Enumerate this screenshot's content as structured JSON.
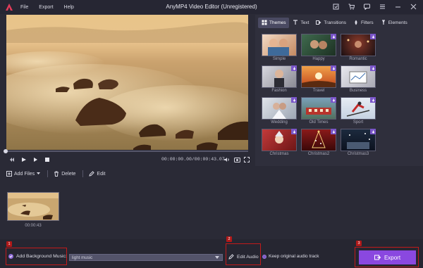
{
  "window": {
    "title": "AnyMP4 Video Editor (Unregistered)",
    "menu": [
      "File",
      "Export",
      "Help"
    ],
    "icons": [
      "register-icon",
      "cart-icon",
      "feedback-icon",
      "menu-icon",
      "minimize-icon",
      "close-icon"
    ]
  },
  "player": {
    "timecode": "00:00:00.00/00:00:43.07",
    "progress": 0.0
  },
  "panel": {
    "tabs": [
      {
        "label": "Themes",
        "icon": "themes-icon"
      },
      {
        "label": "Text",
        "icon": "text-icon"
      },
      {
        "label": "Transitions",
        "icon": "transitions-icon"
      },
      {
        "label": "Filters",
        "icon": "filters-icon"
      },
      {
        "label": "Elements",
        "icon": "elements-icon"
      }
    ],
    "themes": [
      {
        "label": "Simple",
        "download": false
      },
      {
        "label": "Happy",
        "download": true
      },
      {
        "label": "Romantic",
        "download": true
      },
      {
        "label": "Fashion",
        "download": true
      },
      {
        "label": "Travel",
        "download": true
      },
      {
        "label": "Business",
        "download": true
      },
      {
        "label": "Wedding",
        "download": true
      },
      {
        "label": "Old Times",
        "download": true
      },
      {
        "label": "Sport",
        "download": true
      },
      {
        "label": "Christmas",
        "download": true
      },
      {
        "label": "Christmas2",
        "download": true
      },
      {
        "label": "Christmas3",
        "download": true
      }
    ]
  },
  "toolbar": {
    "add_files": "Add Files",
    "delete": "Delete",
    "edit": "Edit"
  },
  "clip": {
    "duration": "00:00:43"
  },
  "bottom": {
    "step1": "1",
    "step2": "2",
    "step3": "3",
    "add_bgm_label": "Add Background Music:",
    "music_value": "light music",
    "edit_audio": "Edit Audio",
    "keep_original": "Keep original audio track",
    "export": "Export"
  },
  "colors": {
    "accent": "#8a48e0",
    "highlight_box": "#c21a1a",
    "background": "#2a2a36"
  }
}
